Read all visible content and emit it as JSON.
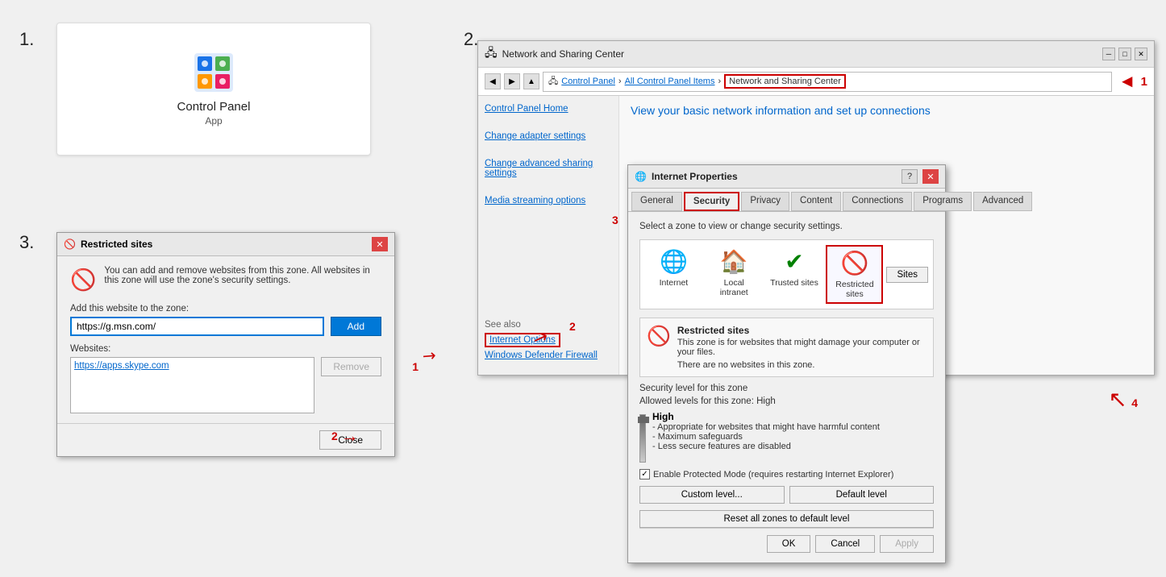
{
  "steps": {
    "step1_num": "1.",
    "step2_num": "2.",
    "step3_num": "3."
  },
  "section1": {
    "app_name": "Control Panel",
    "app_label": "App"
  },
  "section2": {
    "titlebar_title": "Network and Sharing Center",
    "breadcrumb_parts": [
      "Control Panel",
      "All Control Panel Items",
      "Network and Sharing Center"
    ],
    "breadcrumb_highlight": "Network and Sharing Center",
    "annotation_num": "1",
    "network_heading": "View your basic network information and set up connections",
    "sidebar_home": "Control Panel Home",
    "sidebar_link1": "Change adapter settings",
    "sidebar_link2": "Change advanced sharing settings",
    "sidebar_link3": "Media streaming options",
    "see_also_title": "See also",
    "see_also_link": "Internet Options",
    "see_also_link2": "Windows Defender Firewall",
    "annotation2_num": "2"
  },
  "inet_dialog": {
    "title": "Internet Properties",
    "tabs": [
      "General",
      "Security",
      "Privacy",
      "Content",
      "Connections",
      "Programs",
      "Advanced"
    ],
    "active_tab": "Security",
    "zone_instruction": "Select a zone to view or change security settings.",
    "zones": [
      {
        "label": "Internet",
        "icon": "🌐"
      },
      {
        "label": "Local intranet",
        "icon": "🏠"
      },
      {
        "label": "Trusted sites",
        "icon": "✔️"
      },
      {
        "label": "Restricted sites",
        "icon": "🚫"
      }
    ],
    "selected_zone": "Restricted sites",
    "zone_title": "Restricted sites",
    "zone_desc": "This zone is for websites that might damage your computer or your files.",
    "no_sites_text": "There are no websites in this zone.",
    "sites_btn": "Sites",
    "sec_level_title": "Security level for this zone",
    "allowed_levels": "Allowed levels for this zone: High",
    "high_title": "High",
    "high_desc1": "- Appropriate for websites that might have harmful content",
    "high_desc2": "- Maximum safeguards",
    "high_desc3": "- Less secure features are disabled",
    "protected_mode_label": "Enable Protected Mode (requires restarting Internet Explorer)",
    "custom_level_btn": "Custom level...",
    "default_level_btn": "Default level",
    "reset_btn": "Reset all zones to default level",
    "ok_btn": "OK",
    "cancel_btn": "Cancel",
    "apply_btn": "Apply",
    "annotation3_num": "3",
    "annotation4_num": "4"
  },
  "section3": {
    "title": "Restricted sites",
    "info_text": "You can add and remove websites from this zone. All websites in this zone will use the zone's security settings.",
    "add_label": "Add this website to the zone:",
    "input_value": "https://g.msn.com/",
    "add_btn": "Add",
    "websites_label": "Websites:",
    "website_item": "https://apps.skype.com",
    "remove_btn": "Remove",
    "close_btn": "Close",
    "annotation1_num": "1",
    "annotation2_num": "2"
  }
}
